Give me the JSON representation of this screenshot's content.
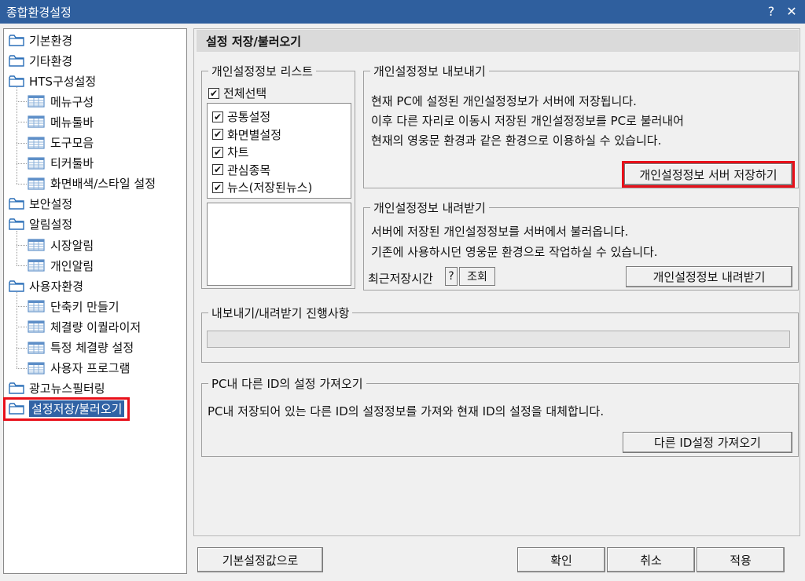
{
  "window": {
    "title": "종합환경설정",
    "help_glyph": "?",
    "close_glyph": "✕"
  },
  "tree": {
    "items": [
      {
        "label": "기본환경",
        "type": "folder"
      },
      {
        "label": "기타환경",
        "type": "folder"
      },
      {
        "label": "HTS구성설정",
        "type": "folder"
      },
      {
        "label": "메뉴구성",
        "type": "leaf"
      },
      {
        "label": "메뉴툴바",
        "type": "leaf"
      },
      {
        "label": "도구모음",
        "type": "leaf"
      },
      {
        "label": "티커툴바",
        "type": "leaf"
      },
      {
        "label": "화면배색/스타일 설정",
        "type": "leaf"
      },
      {
        "label": "보안설정",
        "type": "folder"
      },
      {
        "label": "알림설정",
        "type": "folder"
      },
      {
        "label": "시장알림",
        "type": "leaf"
      },
      {
        "label": "개인알림",
        "type": "leaf"
      },
      {
        "label": "사용자환경",
        "type": "folder"
      },
      {
        "label": "단축키 만들기",
        "type": "leaf"
      },
      {
        "label": "체결량 이퀄라이저",
        "type": "leaf"
      },
      {
        "label": "특정 체결량 설정",
        "type": "leaf"
      },
      {
        "label": "사용자 프로그램",
        "type": "leaf"
      },
      {
        "label": "광고뉴스필터링",
        "type": "folder"
      },
      {
        "label": "설정저장/불러오기",
        "type": "folder",
        "selected": true
      }
    ]
  },
  "page": {
    "title": "설정 저장/불러오기"
  },
  "personal_list": {
    "title": "개인설정정보 리스트",
    "select_all": "전체선택",
    "items": [
      "공통설정",
      "화면별설정",
      "차트",
      "관심종목",
      "뉴스(저장된뉴스)"
    ]
  },
  "export": {
    "title": "개인설정정보 내보내기",
    "lines": [
      "현재 PC에 설정된 개인설정정보가 서버에 저장됩니다.",
      "이후 다른 자리로 이동시 저장된 개인설정정보를 PC로 불러내어",
      "현재의 영웅문 환경과 같은 환경으로 이용하실 수 있습니다."
    ],
    "button": "개인설정정보 서버 저장하기"
  },
  "import": {
    "title": "개인설정정보 내려받기",
    "lines": [
      "서버에 저장된 개인설정정보를 서버에서 불러옵니다.",
      "기존에 사용하시던 영웅문 환경으로 작업하실 수 있습니다."
    ],
    "recent_label": "최근저장시간",
    "recent_value": "?",
    "lookup_button": "조회",
    "button": "개인설정정보 내려받기"
  },
  "progress": {
    "title": "내보내기/내려받기 진행사항"
  },
  "other_id": {
    "title": "PC내 다른 ID의 설정 가져오기",
    "text": "PC내 저장되어 있는 다른 ID의 설정정보를 가져와 현재 ID의 설정을 대체합니다.",
    "button": "다른 ID설정 가져오기"
  },
  "footer": {
    "default_button": "기본설정값으로",
    "ok": "확인",
    "cancel": "취소",
    "apply": "적용"
  },
  "colors": {
    "titlebar": "#2f5f9e",
    "selection": "#3163a5",
    "highlight": "#e8101a"
  }
}
